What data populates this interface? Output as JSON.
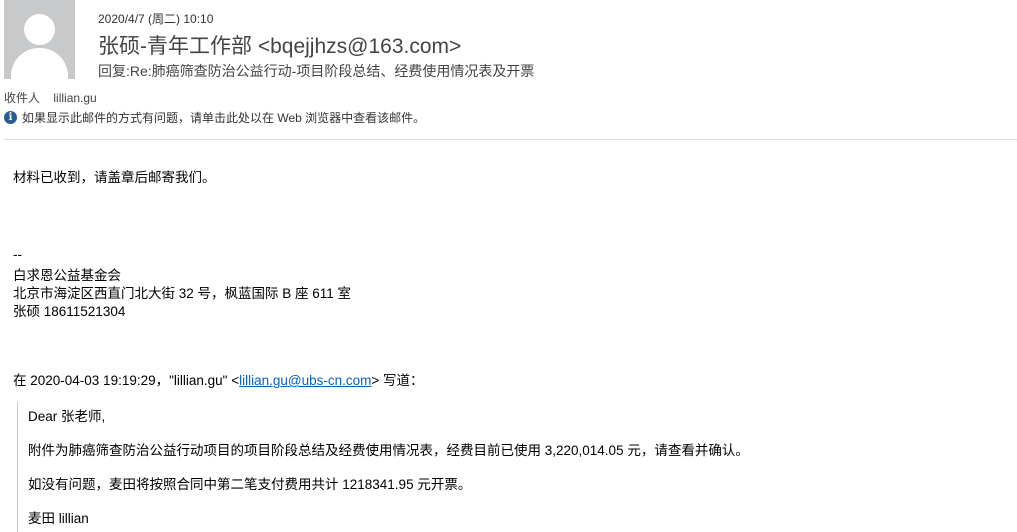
{
  "header": {
    "date": "2020/4/7 (周二) 10:10",
    "sender": "张硕-青年工作部 <bqejjhzs@163.com>",
    "subject": "回复:Re:肺癌筛查防治公益行动-项目阶段总结、经费使用情况表及开票",
    "recipient_label": "收件人",
    "recipient": "lillian.gu",
    "info_text": "如果显示此邮件的方式有问题，请单击此处以在 Web 浏览器中查看该邮件。"
  },
  "body": {
    "line1": "材料已收到，请盖章后邮寄我们。",
    "sig_sep": "--",
    "sig_org": "白求恩公益基金会",
    "sig_addr": "北京市海淀区西直门北大街 32 号，枫蓝国际 B 座 611 室",
    "sig_contact": "张硕 18611521304",
    "reply_prefix": "在 2020-04-03 19:19:29，\"lillian.gu\" <",
    "reply_email": "lillian.gu@ubs-cn.com",
    "reply_suffix": "> 写道：",
    "quoted": {
      "greeting": "Dear 张老师,",
      "p1": "附件为肺癌筛查防治公益行动项目的项目阶段总结及经费使用情况表，经费目前已使用 3,220,014.05 元，请查看并确认。",
      "p2": "如没有问题，麦田将按照合同中第二笔支付费用共计 1218341.95 元开票。",
      "p3": "麦田 lillian"
    }
  },
  "icons": {
    "avatar": "person-avatar-icon",
    "info": "info-icon"
  },
  "colors": {
    "link": "#0563c1",
    "info_icon": "#2a5a93"
  }
}
